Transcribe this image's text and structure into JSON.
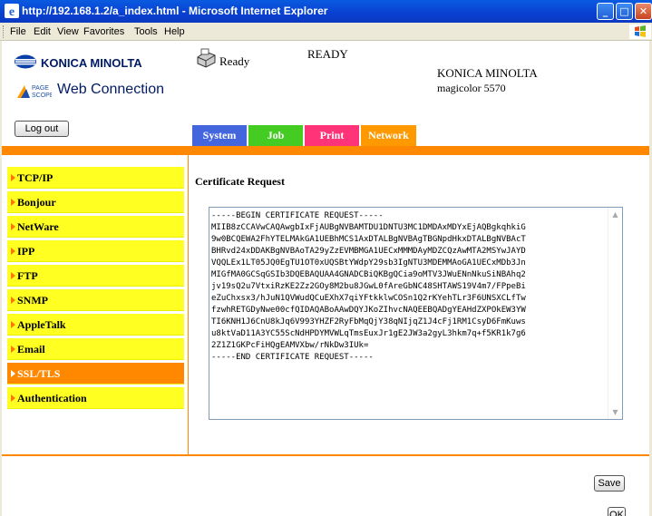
{
  "window": {
    "title": "http://192.168.1.2/a_index.html - Microsoft Internet Explorer",
    "minimize": "_",
    "maximize": "□",
    "close": "✕"
  },
  "menu": {
    "items": [
      "File",
      "Edit",
      "View",
      "Favorites",
      "Tools",
      "Help"
    ]
  },
  "header": {
    "brand_logo_text": "KONICA MINOLTA",
    "pagescope_text": "Web Connection",
    "status": "Ready",
    "device_status": "READY",
    "brand_name": "KONICA MINOLTA",
    "model": "magicolor 5570"
  },
  "buttons": {
    "logout": "Log out",
    "save": "Save",
    "ok": "OK"
  },
  "tabs": [
    "System",
    "Job",
    "Print",
    "Network"
  ],
  "sidebar": {
    "items": [
      {
        "label": "TCP/IP",
        "active": false
      },
      {
        "label": "Bonjour",
        "active": false
      },
      {
        "label": "NetWare",
        "active": false
      },
      {
        "label": "IPP",
        "active": false
      },
      {
        "label": "FTP",
        "active": false
      },
      {
        "label": "SNMP",
        "active": false
      },
      {
        "label": "AppleTalk",
        "active": false
      },
      {
        "label": "Email",
        "active": false
      },
      {
        "label": "SSL/TLS",
        "active": true
      },
      {
        "label": "Authentication",
        "active": false
      }
    ]
  },
  "main": {
    "title": "Certificate Request",
    "certificate": "-----BEGIN CERTIFICATE REQUEST-----\nMIIB8zCCAVwCAQAwgbIxFjAUBgNVBAMTDU1DNTU3MC1DMDAxMDYxEjAQBgkqhkiG\n9w0BCQEWA2FhYTELMAkGA1UEBhMCS1AxDTALBgNVBAgTBGNpdHkxDTALBgNVBAcT\nBHRvd24xDDAKBgNVBAoTA29yZzEVMBMGA1UECxMMMDAyMDZCQzAwMTA2MSYwJAYD\nVQQLEx1LT05JQ0EgTU1OT0xUQSBtYWdpY29sb3IgNTU3MDEMMAoGA1UECxMDb3Jn\nMIGfMA0GCSqGSIb3DQEBAQUAA4GNADCBiQKBgQCia9oMTV3JWuENnNkuSiNBAhq2\njv19sQ2u7VtxiRzKE2Zz2GOy8M2bu8JGwL0fAreGbNC48SHTAWS19V4m7/FPpeBi\neZuChxsx3/hJuN1QVWudQCuEXhX7qiYFtkklwCOSn1Q2rKYehTLr3F6UNSXCLfTw\nfzwhRETGDyNwe00cfQIDAQABoAAwDQYJKoZIhvcNAQEEBQADgYEAHdZXPOkEW3YW\nTI6KNH1J6CnU8kJq6V993YHZF2RyFbMqQjY38qNIjqZ1J4cFj1RM1CsyD6FmKuws\nu8ktVaD11A3YC55ScNdHPDYMVWLqTmsEuxJr1gE2JW3a2gyL3hkm7q+f5KR1k7g6\n2Z1Z1GKPcFiHQgEAMVXbw/rNkDw3IUk=\n-----END CERTIFICATE REQUEST-----"
  },
  "colors": {
    "accent_orange": "#ff8800",
    "sidebar_yellow": "#ffff22",
    "tab_system": "#4466dd",
    "tab_job": "#44cc22",
    "tab_print": "#ff3377",
    "tab_network": "#ff9900"
  }
}
